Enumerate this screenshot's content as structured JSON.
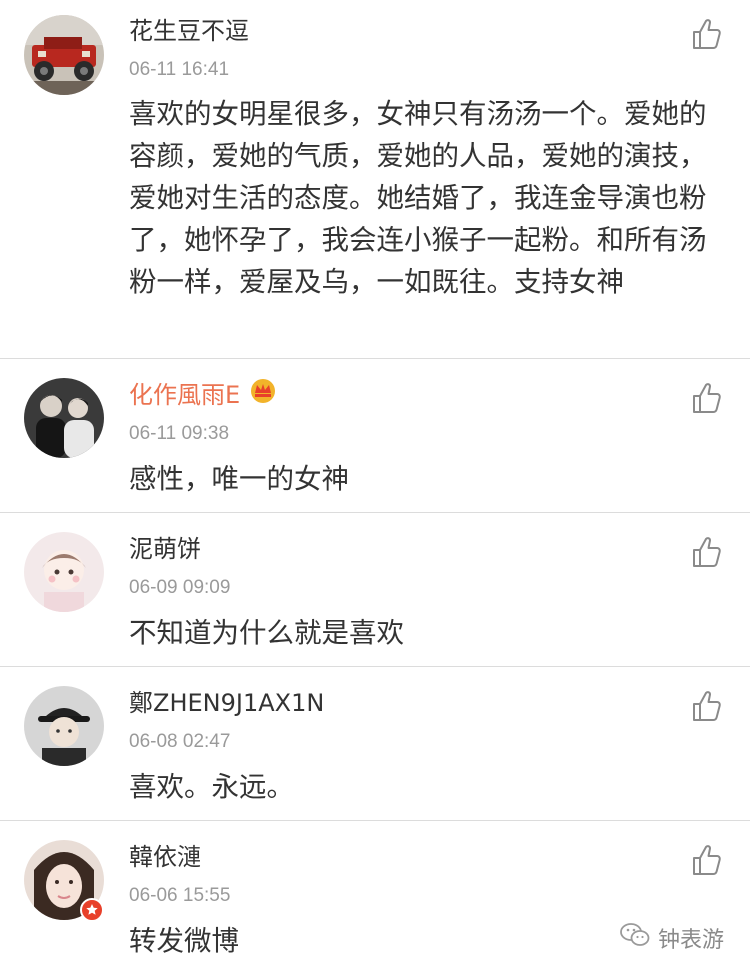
{
  "comments": [
    {
      "username": "花生豆不逗",
      "timestamp": "06-11 16:41",
      "text": "喜欢的女明星很多，女神只有汤汤一个。爱她的容颜，爱她的气质，爱她的人品，爱她的演技，爱她对生活的态度。她结婚了，我连金导演也粉了，她怀孕了，我会连小猴子一起粉。和所有汤粉一样，爱屋及乌，一如既往。支持女神",
      "avatar_icon": "jeep-avatar"
    },
    {
      "username": "化作風雨E",
      "timestamp": "06-11 09:38",
      "text": "感性，唯一的女神",
      "avatar_icon": "two-people-avatar",
      "vip_badge_icon": "crown-icon"
    },
    {
      "username": "泥萌饼",
      "timestamp": "06-09 09:09",
      "text": "不知道为什么就是喜欢",
      "avatar_icon": "cartoon-girl-avatar"
    },
    {
      "username": "鄭ZHEN9J1AX1N",
      "timestamp": "06-08 02:47",
      "text": "喜欢。永远。",
      "avatar_icon": "man-cap-avatar"
    },
    {
      "username": "韓依漣",
      "timestamp": "06-06 15:55",
      "text": "转发微博",
      "avatar_icon": "woman-face-avatar",
      "verified_badge_icon": "star-badge-icon"
    }
  ],
  "like_icon": "thumbs-up-icon",
  "watermark": {
    "text": "钟表游",
    "icon": "wechat-icon"
  },
  "colors": {
    "vip_name": "#eb7350",
    "timestamp": "#9a9a9a",
    "text": "#333333",
    "divider": "#dcdcdc"
  }
}
